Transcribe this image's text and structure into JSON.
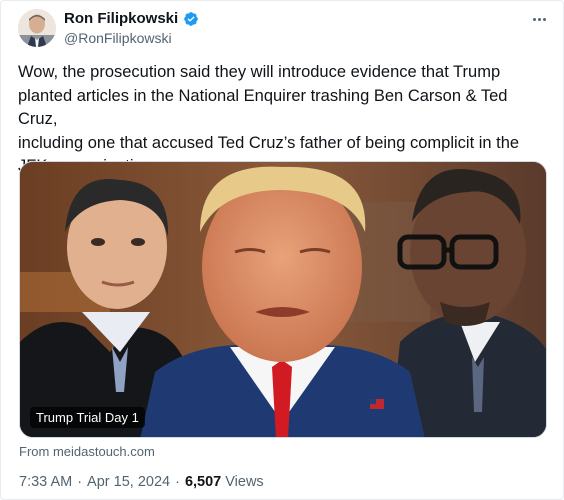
{
  "author": {
    "display_name": "Ron Filipkowski",
    "handle": "@RonFilipkowski",
    "verified": true
  },
  "tweet": {
    "text": "Wow, the prosecution said they will introduce evidence that Trump\nplanted articles in the National Enquirer trashing Ben Carson & Ted Cruz,\nincluding one that accused Ted Cruz’s father of being complicit in the\nJFK assassination."
  },
  "media": {
    "caption": "Trump Trial Day 1",
    "source": "From meidastouch.com"
  },
  "meta": {
    "time": "7:33 AM",
    "date": "Apr 15, 2024",
    "separator": "·",
    "views_count": "6,507",
    "views_label": "Views"
  },
  "colors": {
    "verified_badge": "#1d9bf0",
    "secondary_text": "#536471",
    "primary_text": "#0f1419"
  },
  "icons": {
    "verified": "verified-badge-icon",
    "more": "more-icon"
  }
}
